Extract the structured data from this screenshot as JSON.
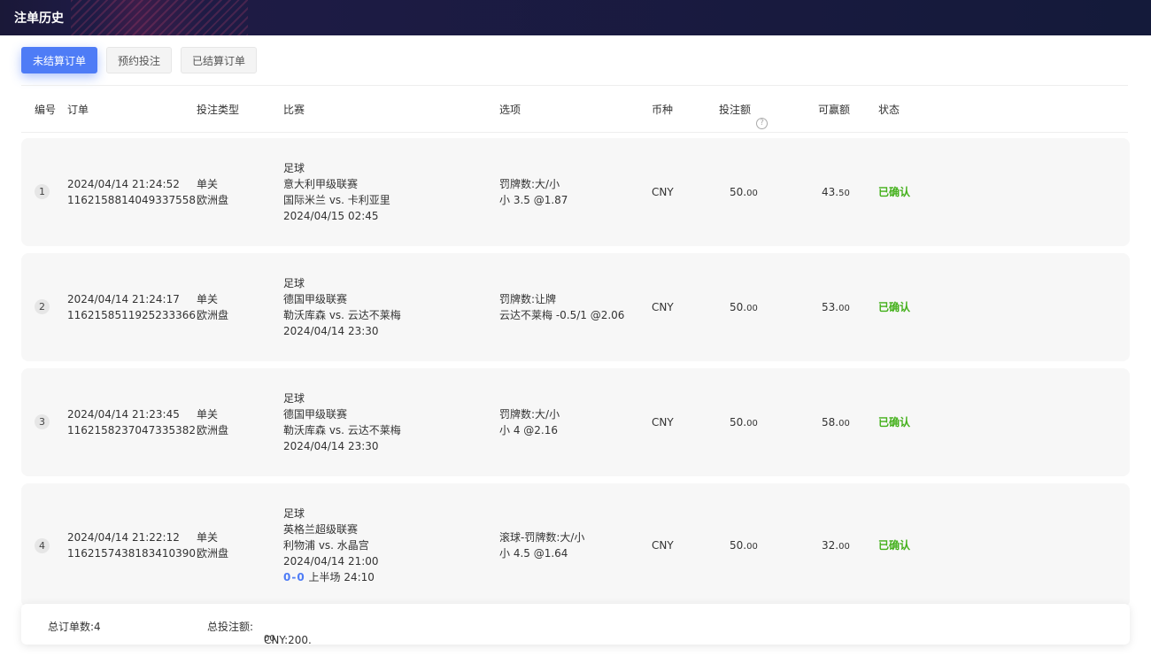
{
  "page": {
    "title": "注单历史"
  },
  "tabs": [
    {
      "label": "未结算订单",
      "active": true
    },
    {
      "label": "预约投注",
      "active": false
    },
    {
      "label": "已结算订单",
      "active": false
    }
  ],
  "columns": {
    "index": "编号",
    "order": "订单",
    "bet_type": "投注类型",
    "match": "比赛",
    "option": "选项",
    "currency": "币种",
    "stake": "投注额",
    "payout": "可赢额",
    "status": "状态"
  },
  "help_icon": "?",
  "rows": [
    {
      "index": "1",
      "time": "2024/04/14 21:24:52",
      "order_id": "1162158814049337558",
      "bet_type": "单关",
      "odds_type": "欧洲盘",
      "sport": "足球",
      "league": "意大利甲级联赛",
      "teams": "国际米兰 vs. 卡利亚里",
      "match_time": "2024/04/15 02:45",
      "option_market": "罚牌数:大/小",
      "option_pick": "小 3.5 @1.87",
      "currency": "CNY",
      "stake_int": "50.",
      "stake_dec": "00",
      "payout_int": "43.",
      "payout_dec": "50",
      "status": "已确认"
    },
    {
      "index": "2",
      "time": "2024/04/14 21:24:17",
      "order_id": "1162158511925233366",
      "bet_type": "单关",
      "odds_type": "欧洲盘",
      "sport": "足球",
      "league": "德国甲级联赛",
      "teams": "勒沃库森 vs. 云达不莱梅",
      "match_time": "2024/04/14 23:30",
      "option_market": "罚牌数:让牌",
      "option_pick": "云达不莱梅 -0.5/1 @2.06",
      "currency": "CNY",
      "stake_int": "50.",
      "stake_dec": "00",
      "payout_int": "53.",
      "payout_dec": "00",
      "status": "已确认"
    },
    {
      "index": "3",
      "time": "2024/04/14 21:23:45",
      "order_id": "1162158237047335382",
      "bet_type": "单关",
      "odds_type": "欧洲盘",
      "sport": "足球",
      "league": "德国甲级联赛",
      "teams": "勒沃库森 vs. 云达不莱梅",
      "match_time": "2024/04/14 23:30",
      "option_market": "罚牌数:大/小",
      "option_pick": "小 4 @2.16",
      "currency": "CNY",
      "stake_int": "50.",
      "stake_dec": "00",
      "payout_int": "58.",
      "payout_dec": "00",
      "status": "已确认"
    },
    {
      "index": "4",
      "time": "2024/04/14 21:22:12",
      "order_id": "1162157438183410390",
      "bet_type": "单关",
      "odds_type": "欧洲盘",
      "sport": "足球",
      "league": "英格兰超级联赛",
      "teams": "利物浦 vs. 水晶宫",
      "match_time": "2024/04/14 21:00",
      "live_score": "0-0",
      "live_period": "上半场",
      "live_clock": "24:10",
      "option_market": "滚球-罚牌数:大/小",
      "option_pick": "小 4.5 @1.64",
      "currency": "CNY",
      "stake_int": "50.",
      "stake_dec": "00",
      "payout_int": "32.",
      "payout_dec": "00",
      "status": "已确认"
    }
  ],
  "footer": {
    "total_orders": "总订单数:4",
    "total_stake_label": "总投注额:",
    "total_stake_value_int": "CNY:200.",
    "total_stake_value_dec": "00"
  },
  "colors": {
    "accent": "#4e7cf6",
    "status": "#43b01a",
    "header_bg": "#141a3a"
  }
}
